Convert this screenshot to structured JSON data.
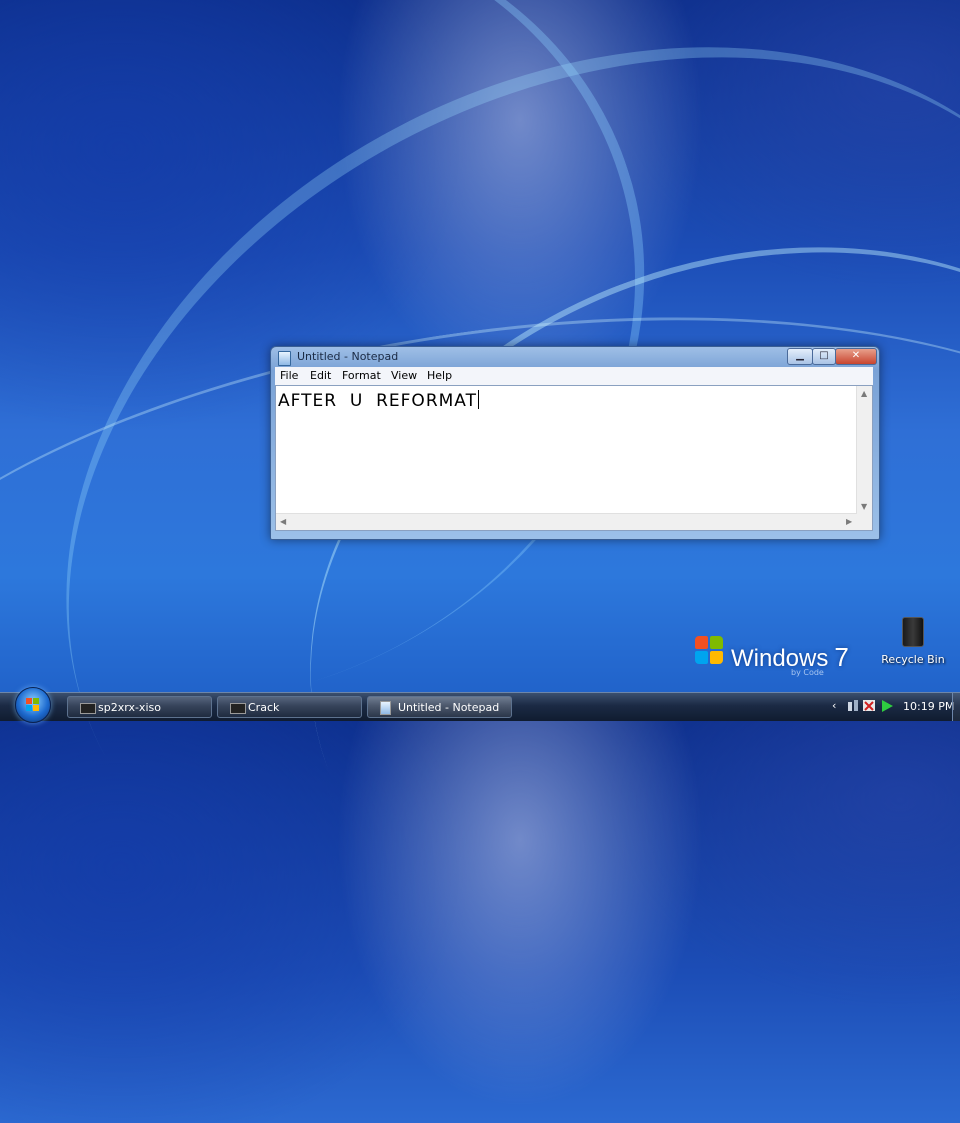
{
  "notepad": {
    "title": "Untitled - Notepad",
    "menu": [
      "File",
      "Edit",
      "Format",
      "View",
      "Help"
    ],
    "content": "AFTER  U  REFORMAT",
    "controls": {
      "minimize": "▁",
      "maximize": "□",
      "close": "✕"
    }
  },
  "desktop": {
    "logo_text": "Windows",
    "logo_version": "7",
    "logo_subtext": "by Code",
    "recycle_bin_label": "Recycle Bin"
  },
  "taskbar": {
    "tasks": [
      {
        "label": "sp2xrx-xiso",
        "icon": "console-icon"
      },
      {
        "label": "Crack",
        "icon": "console-icon"
      },
      {
        "label": "Untitled - Notepad",
        "icon": "notepad-icon"
      }
    ],
    "tray_chevron": "‹",
    "clock": "10:19 PM"
  },
  "colors": {
    "desktop_blue": "#1c4db6",
    "taskbar": "#1b2a44",
    "window_frame": "#9fbfe6",
    "close_red": "#c8452f"
  }
}
